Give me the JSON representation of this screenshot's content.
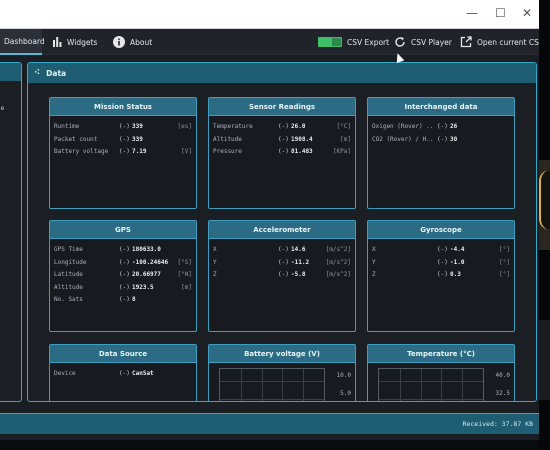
{
  "window": {
    "minimize": "—",
    "maximize": "☐",
    "close": "✕"
  },
  "toolbar": {
    "dashboard": "Dashboard",
    "widgets": "Widgets",
    "about": "About",
    "csv_export": "CSV Export",
    "csv_player": "CSV Player",
    "open_csv": "Open current CSV"
  },
  "left_panel": {
    "text": "le"
  },
  "data_panel": {
    "title": "Data"
  },
  "cards": {
    "mission": {
      "title": "Mission Status",
      "rows": [
        {
          "label": "Runtime",
          "arrow": "(-)",
          "value": "339",
          "unit": "[es]"
        },
        {
          "label": "Packet count",
          "arrow": "(-)",
          "value": "339",
          "unit": ""
        },
        {
          "label": "Battery voltage",
          "arrow": "(-)",
          "value": "7.19",
          "unit": "[V]"
        }
      ]
    },
    "sensor": {
      "title": "Sensor Readings",
      "rows": [
        {
          "label": "Temperature",
          "arrow": "(-)",
          "value": "26.0",
          "unit": "[°C]"
        },
        {
          "label": "Altitude",
          "arrow": "(-)",
          "value": "1908.4",
          "unit": "[m]"
        },
        {
          "label": "Pressure",
          "arrow": "(-)",
          "value": "81.483",
          "unit": "[KPa]"
        }
      ]
    },
    "interchanged": {
      "title": "Interchanged data",
      "rows": [
        {
          "label": "Oxigen (Rover) ..",
          "arrow": "(-)",
          "value": "26",
          "unit": ""
        },
        {
          "label": "CO2 (Rover) / H..",
          "arrow": "(-)",
          "value": "30",
          "unit": ""
        }
      ]
    },
    "gps": {
      "title": "GPS",
      "rows": [
        {
          "label": "GPS Time",
          "arrow": "(-)",
          "value": "180633.0",
          "unit": ""
        },
        {
          "label": "Longitude",
          "arrow": "(-)",
          "value": "-100.24646",
          "unit": "[°S]"
        },
        {
          "label": "Latitude",
          "arrow": "(-)",
          "value": "20.66977",
          "unit": "[°N]"
        },
        {
          "label": "Altitude",
          "arrow": "(-)",
          "value": "1923.5",
          "unit": "[m]"
        },
        {
          "label": "No. Sats",
          "arrow": "(-)",
          "value": "8",
          "unit": ""
        }
      ]
    },
    "accelerometer": {
      "title": "Accelerometer",
      "rows": [
        {
          "label": "X",
          "arrow": "(-)",
          "value": "14.6",
          "unit": "[m/s^2]"
        },
        {
          "label": "Y",
          "arrow": "(-)",
          "value": "-11.2",
          "unit": "[m/s^2]"
        },
        {
          "label": "Z",
          "arrow": "(-)",
          "value": "-5.8",
          "unit": "[m/s^2]"
        }
      ]
    },
    "gyroscope": {
      "title": "Gyroscope",
      "rows": [
        {
          "label": "X",
          "arrow": "(-)",
          "value": "-4.4",
          "unit": "[°]"
        },
        {
          "label": "Y",
          "arrow": "(-)",
          "value": "-1.0",
          "unit": "[°]"
        },
        {
          "label": "Z",
          "arrow": "(-)",
          "value": "0.3",
          "unit": "[°]"
        }
      ]
    },
    "datasource": {
      "title": "Data Source",
      "rows": [
        {
          "label": "Device",
          "arrow": "(-)",
          "value": "CanSat",
          "unit": ""
        }
      ]
    },
    "battery_chart": {
      "title": "Battery voltage (V)",
      "ticks": [
        "10.0",
        "5.0"
      ]
    },
    "temp_chart": {
      "title": "Temperature (°C)",
      "ticks": [
        "40.0",
        "32.5"
      ]
    }
  },
  "status": {
    "received": "Received: 37.87 KB"
  },
  "colors": {
    "accent": "#36a8c8",
    "header": "#1f5d73",
    "card_header": "#2b6b84",
    "toggle": "#3fbf6a"
  },
  "icons": {
    "dashboard": "dashboard-icon",
    "widgets": "bar-chart-icon",
    "about": "info-icon",
    "csv_export_toggle": "toggle-icon",
    "csv_player": "refresh-icon",
    "open_csv": "external-link-icon",
    "data": "sparkle-icon"
  }
}
